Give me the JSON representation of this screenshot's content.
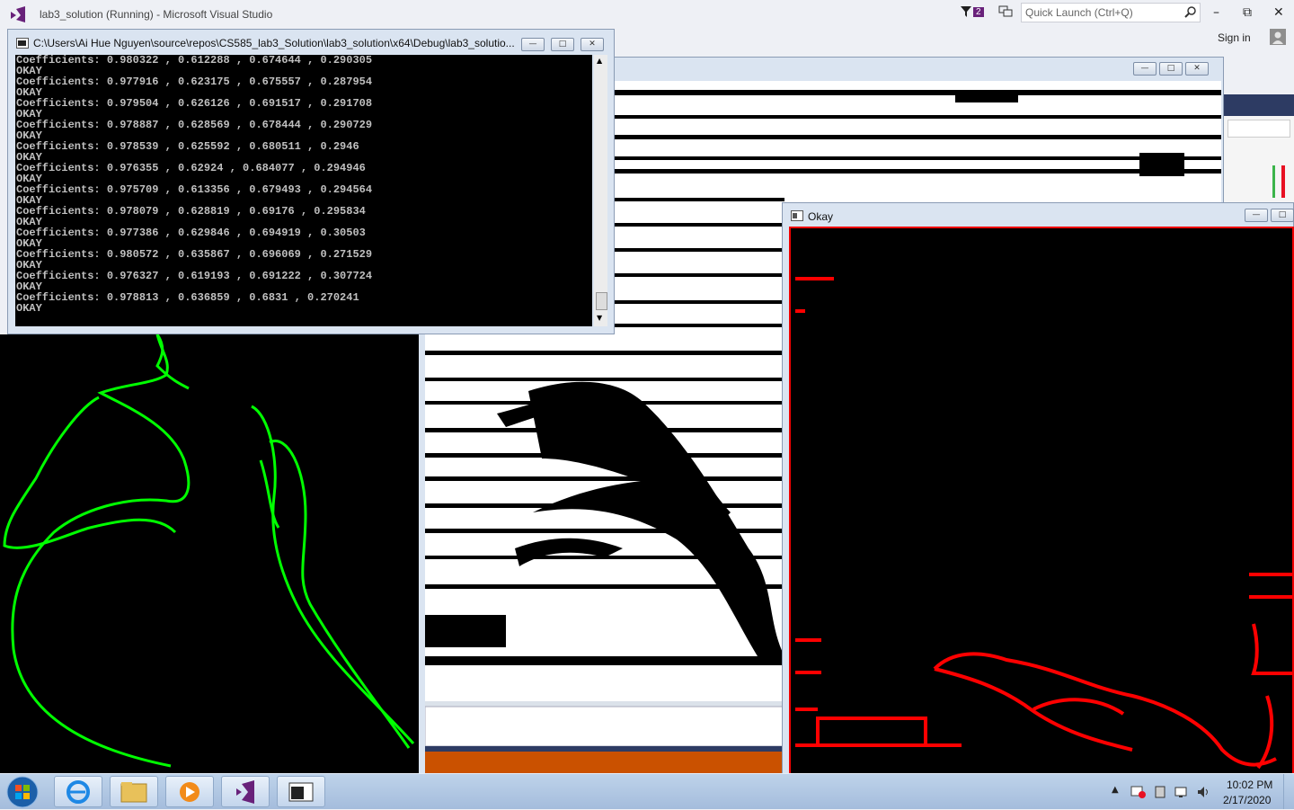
{
  "vs": {
    "title": "lab3_solution (Running) - Microsoft Visual Studio",
    "quick_launch": "Quick Launch (Ctrl+Q)",
    "signin": "Sign in",
    "notif_count": "2"
  },
  "console": {
    "title": "C:\\Users\\Ai Hue Nguyen\\source\\repos\\CS585_lab3_Solution\\lab3_solution\\x64\\Debug\\lab3_solutio...",
    "lines": [
      "Coefficients: 0.980322 , 0.612288 , 0.674644 , 0.290305",
      "OKAY",
      "Coefficients: 0.977916 , 0.623175 , 0.675557 , 0.287954",
      "OKAY",
      "Coefficients: 0.979504 , 0.626126 , 0.691517 , 0.291708",
      "OKAY",
      "Coefficients: 0.978887 , 0.628569 , 0.678444 , 0.290729",
      "OKAY",
      "Coefficients: 0.978539 , 0.625592 , 0.680511 , 0.2946",
      "OKAY",
      "Coefficients: 0.976355 , 0.62924 , 0.684077 , 0.294946",
      "OKAY",
      "Coefficients: 0.975709 , 0.613356 , 0.679493 , 0.294564",
      "OKAY",
      "Coefficients: 0.978079 , 0.628819 , 0.69176 , 0.295834",
      "OKAY",
      "Coefficients: 0.977386 , 0.629846 , 0.694919 , 0.30503",
      "OKAY",
      "Coefficients: 0.980572 , 0.635867 , 0.696069 , 0.271529",
      "OKAY",
      "Coefficients: 0.976327 , 0.619193 , 0.691222 , 0.307724",
      "OKAY",
      "Coefficients: 0.978813 , 0.636859 , 0.6831 , 0.270241",
      "OKAY"
    ]
  },
  "okay_window": {
    "title": "Okay"
  },
  "taskbar": {
    "time": "10:02 PM",
    "date": "2/17/2020"
  },
  "colors": {
    "contour_green": "#00ff00",
    "contour_red": "#ff0000",
    "console_bg": "#000000"
  }
}
